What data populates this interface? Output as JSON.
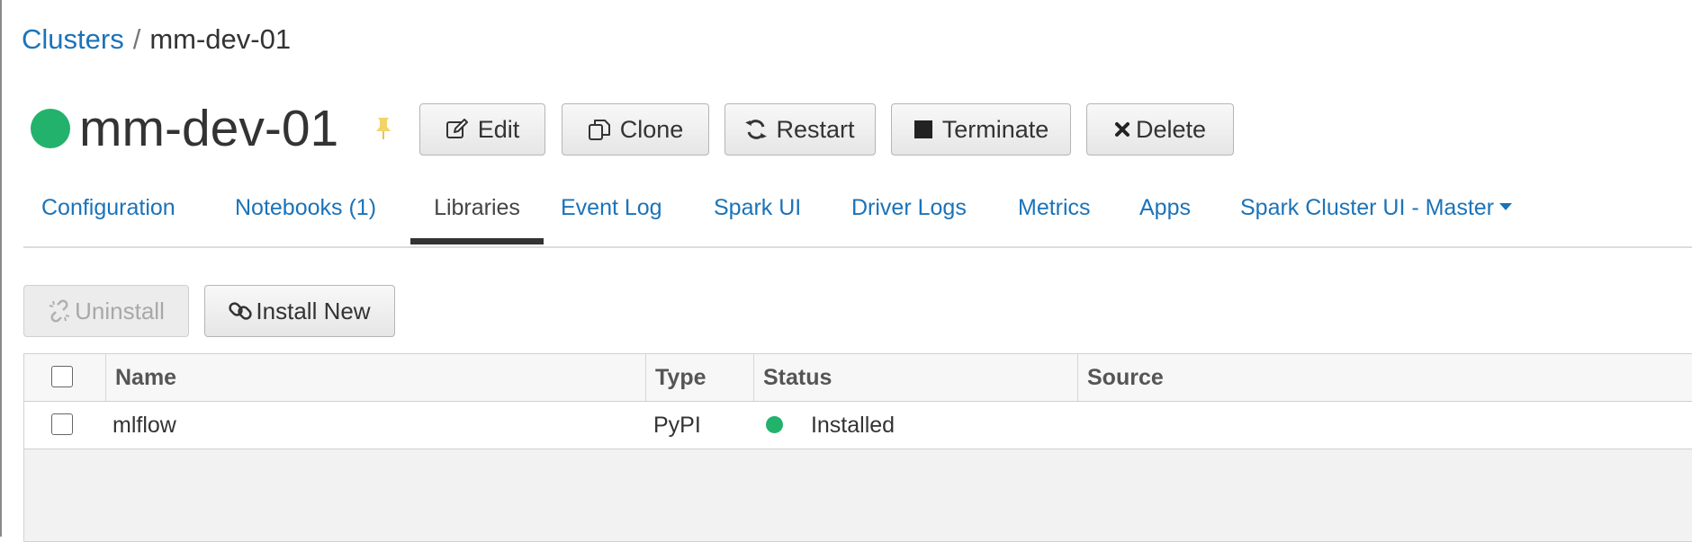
{
  "breadcrumb": {
    "parent": "Clusters",
    "separator": "/",
    "current": "mm-dev-01"
  },
  "cluster": {
    "name": "mm-dev-01",
    "status_color": "#22b26c",
    "pin_color": "#f2d46a"
  },
  "actions": {
    "edit": "Edit",
    "clone": "Clone",
    "restart": "Restart",
    "terminate": "Terminate",
    "delete": "Delete"
  },
  "tabs": [
    {
      "label": "Configuration"
    },
    {
      "label": "Notebooks (1)"
    },
    {
      "label": "Libraries",
      "active": true
    },
    {
      "label": "Event Log"
    },
    {
      "label": "Spark UI"
    },
    {
      "label": "Driver Logs"
    },
    {
      "label": "Metrics"
    },
    {
      "label": "Apps"
    },
    {
      "label": "Spark Cluster UI - Master",
      "dropdown": true
    }
  ],
  "library_actions": {
    "uninstall": "Uninstall",
    "install_new": "Install New"
  },
  "table": {
    "columns": [
      "Name",
      "Type",
      "Status",
      "Source"
    ],
    "rows": [
      {
        "name": "mlflow",
        "type": "PyPI",
        "status": "Installed",
        "status_color": "#22b26c",
        "source": ""
      }
    ]
  },
  "colors": {
    "link": "#1b73b8",
    "accent_green": "#22b26c"
  }
}
